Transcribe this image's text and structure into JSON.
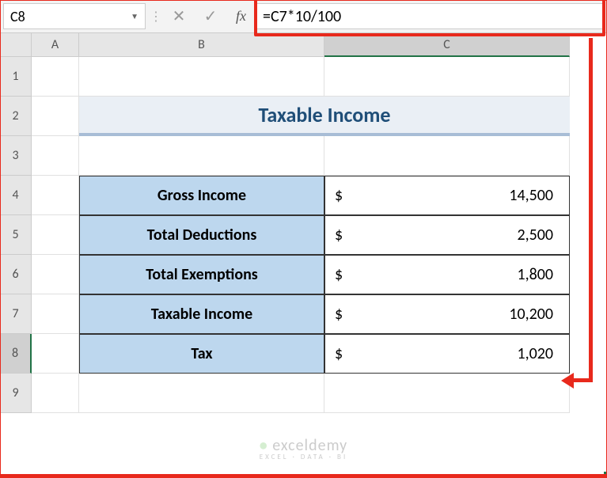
{
  "name_box": "C8",
  "formula": "=C7*10/100",
  "fx_label": "fx",
  "columns": [
    "A",
    "B",
    "C"
  ],
  "rows": [
    "1",
    "2",
    "3",
    "4",
    "5",
    "6",
    "7",
    "8",
    "9"
  ],
  "title": "Taxable Income",
  "table": [
    {
      "label": "Gross Income",
      "currency": "$",
      "value": "14,500"
    },
    {
      "label": "Total Deductions",
      "currency": "$",
      "value": "2,500"
    },
    {
      "label": "Total Exemptions",
      "currency": "$",
      "value": "1,800"
    },
    {
      "label": "Taxable Income",
      "currency": "$",
      "value": "10,200"
    },
    {
      "label": "Tax",
      "currency": "$",
      "value": "1,020"
    }
  ],
  "selected_cell": "C8",
  "watermark": {
    "brand": "exceldemy",
    "sub": "EXCEL · DATA · BI"
  },
  "chart_data": {
    "type": "table",
    "categories": [
      "Gross Income",
      "Total Deductions",
      "Total Exemptions",
      "Taxable Income",
      "Tax"
    ],
    "values": [
      14500,
      2500,
      1800,
      10200,
      1020
    ],
    "title": "Taxable Income"
  }
}
